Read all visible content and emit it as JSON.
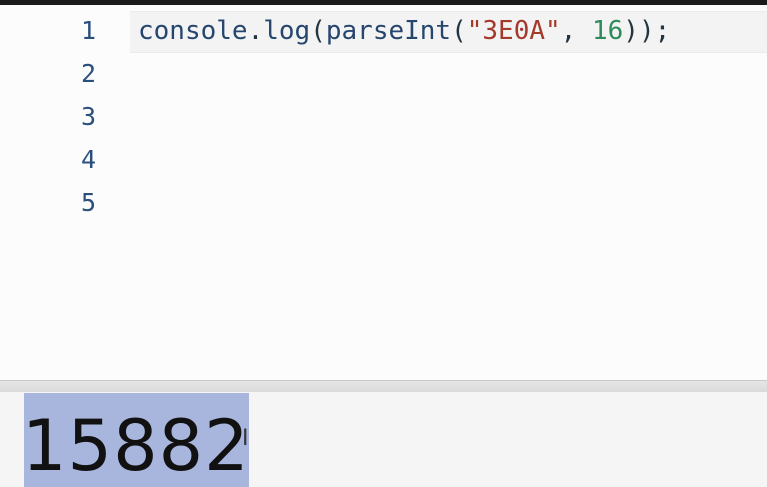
{
  "editor": {
    "line_numbers": [
      "1",
      "2",
      "3",
      "4",
      "5"
    ],
    "code_line_1": {
      "ident": "console",
      "dot": ".",
      "method": "log",
      "open_paren": "(",
      "function": "parseInt",
      "open_paren_2": "(",
      "string_literal": "\"3E0A\"",
      "comma": ", ",
      "number_literal": "16",
      "closing": "));"
    }
  },
  "console": {
    "output": "15882",
    "cursor_glyph": "I"
  },
  "colors": {
    "string": "#a43a2a",
    "number": "#2f8c5a",
    "identifier": "#26466e",
    "selection": "#a8b5dc"
  }
}
